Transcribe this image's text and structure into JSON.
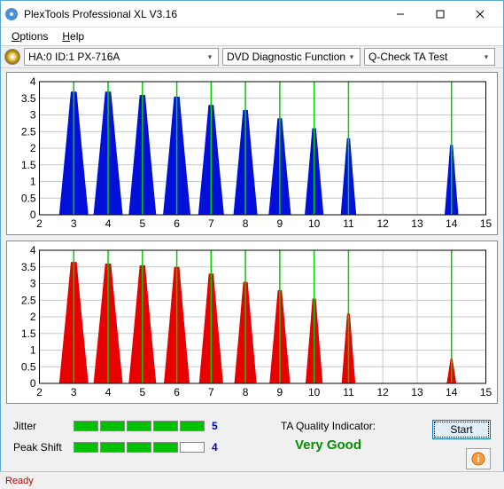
{
  "window": {
    "title": "PlexTools Professional XL V3.16"
  },
  "menu": {
    "options": "Options",
    "help": "Help"
  },
  "toolbar": {
    "device": "HA:0 ID:1  PX-716A",
    "functions": "DVD Diagnostic Functions",
    "test": "Q-Check TA Test"
  },
  "chart_data": [
    {
      "type": "bar",
      "color": "#0010d8",
      "xlim": [
        2,
        15
      ],
      "ylim": [
        0,
        4
      ],
      "xticks": [
        2,
        3,
        4,
        5,
        6,
        7,
        8,
        9,
        10,
        11,
        12,
        13,
        14,
        15
      ],
      "yticks": [
        0,
        0.5,
        1,
        1.5,
        2,
        2.5,
        3,
        3.5,
        4
      ],
      "peaks": [
        {
          "center": 3,
          "height": 3.7,
          "width": 0.85
        },
        {
          "center": 4,
          "height": 3.7,
          "width": 0.85
        },
        {
          "center": 5,
          "height": 3.6,
          "width": 0.8
        },
        {
          "center": 6,
          "height": 3.55,
          "width": 0.8
        },
        {
          "center": 7,
          "height": 3.3,
          "width": 0.75
        },
        {
          "center": 8,
          "height": 3.15,
          "width": 0.7
        },
        {
          "center": 9,
          "height": 2.9,
          "width": 0.65
        },
        {
          "center": 10,
          "height": 2.6,
          "width": 0.55
        },
        {
          "center": 11,
          "height": 2.3,
          "width": 0.45
        },
        {
          "center": 14,
          "height": 2.1,
          "width": 0.4
        }
      ]
    },
    {
      "type": "bar",
      "color": "#e80000",
      "xlim": [
        2,
        15
      ],
      "ylim": [
        0,
        4
      ],
      "xticks": [
        2,
        3,
        4,
        5,
        6,
        7,
        8,
        9,
        10,
        11,
        12,
        13,
        14,
        15
      ],
      "yticks": [
        0,
        0.5,
        1,
        1.5,
        2,
        2.5,
        3,
        3.5,
        4
      ],
      "peaks": [
        {
          "center": 3,
          "height": 3.65,
          "width": 0.85
        },
        {
          "center": 4,
          "height": 3.6,
          "width": 0.85
        },
        {
          "center": 5,
          "height": 3.55,
          "width": 0.8
        },
        {
          "center": 6,
          "height": 3.5,
          "width": 0.75
        },
        {
          "center": 7,
          "height": 3.3,
          "width": 0.7
        },
        {
          "center": 8,
          "height": 3.05,
          "width": 0.65
        },
        {
          "center": 9,
          "height": 2.8,
          "width": 0.6
        },
        {
          "center": 10,
          "height": 2.55,
          "width": 0.5
        },
        {
          "center": 11,
          "height": 2.1,
          "width": 0.4
        },
        {
          "center": 14,
          "height": 0.75,
          "width": 0.28
        }
      ]
    }
  ],
  "metrics": {
    "jitter": {
      "label": "Jitter",
      "segments": 5,
      "filled": 5,
      "value": "5"
    },
    "peakshift": {
      "label": "Peak Shift",
      "segments": 5,
      "filled": 4,
      "value": "4"
    }
  },
  "ta": {
    "label": "TA Quality Indicator:",
    "value": "Very Good"
  },
  "buttons": {
    "start": "Start"
  },
  "status": {
    "text": "Ready"
  }
}
